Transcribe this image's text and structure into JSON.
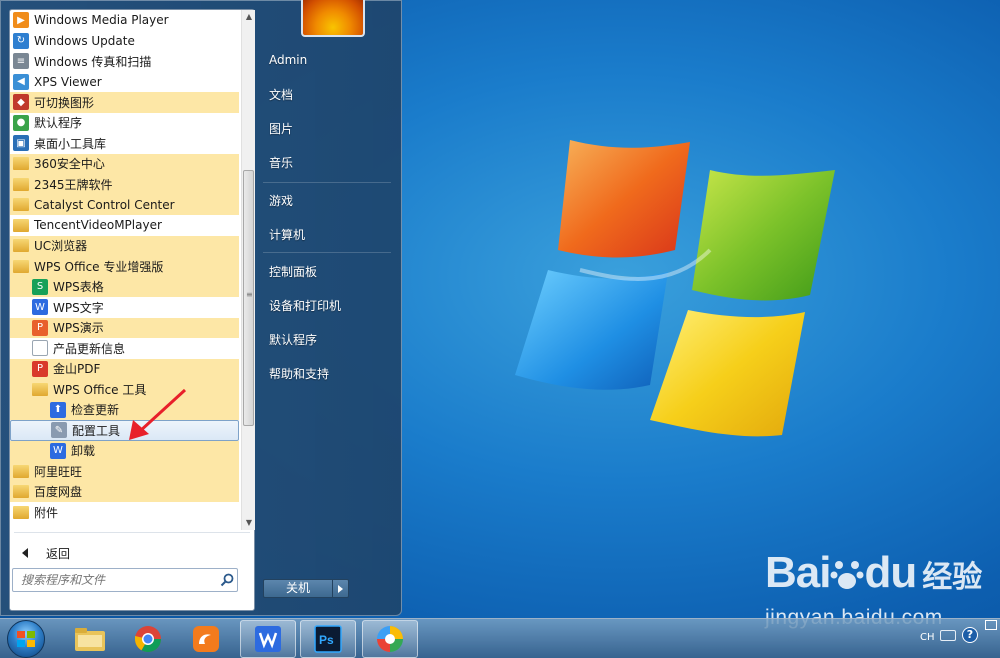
{
  "programs": [
    {
      "label": "Windows Media Player",
      "icon": "media-player-icon",
      "level": 0,
      "highlight": false
    },
    {
      "label": "Windows Update",
      "icon": "windows-update-icon",
      "level": 0,
      "highlight": false
    },
    {
      "label": "Windows 传真和扫描",
      "icon": "fax-scan-icon",
      "level": 0,
      "highlight": false
    },
    {
      "label": "XPS Viewer",
      "icon": "xps-viewer-icon",
      "level": 0,
      "highlight": false
    },
    {
      "label": "可切换图形",
      "icon": "switchable-graphics-icon",
      "level": 0,
      "highlight": true
    },
    {
      "label": "默认程序",
      "icon": "default-programs-icon",
      "level": 0,
      "highlight": false
    },
    {
      "label": "桌面小工具库",
      "icon": "gadgets-icon",
      "level": 0,
      "highlight": false
    },
    {
      "label": "360安全中心",
      "icon": "folder-icon",
      "level": 0,
      "highlight": true
    },
    {
      "label": "2345王牌软件",
      "icon": "folder-icon",
      "level": 0,
      "highlight": true
    },
    {
      "label": "Catalyst Control Center",
      "icon": "folder-icon",
      "level": 0,
      "highlight": true
    },
    {
      "label": "TencentVideoMPlayer",
      "icon": "folder-icon",
      "level": 0,
      "highlight": false
    },
    {
      "label": "UC浏览器",
      "icon": "folder-icon",
      "level": 0,
      "highlight": true
    },
    {
      "label": "WPS Office 专业增强版",
      "icon": "folder-icon",
      "level": 0,
      "highlight": true
    },
    {
      "label": "WPS表格",
      "icon": "wps-spreadsheet-icon",
      "level": 1,
      "highlight": true
    },
    {
      "label": "WPS文字",
      "icon": "wps-writer-icon",
      "level": 1,
      "highlight": false
    },
    {
      "label": "WPS演示",
      "icon": "wps-presentation-icon",
      "level": 1,
      "highlight": true
    },
    {
      "label": "产品更新信息",
      "icon": "document-icon",
      "level": 1,
      "highlight": false
    },
    {
      "label": "金山PDF",
      "icon": "kingsoft-pdf-icon",
      "level": 1,
      "highlight": true
    },
    {
      "label": "WPS Office 工具",
      "icon": "folder-icon",
      "level": 1,
      "highlight": true
    },
    {
      "label": "检查更新",
      "icon": "check-update-icon",
      "level": 2,
      "highlight": true
    },
    {
      "label": "配置工具",
      "icon": "config-tool-icon",
      "level": 2,
      "highlight": false,
      "selected": true
    },
    {
      "label": "卸载",
      "icon": "uninstall-icon",
      "level": 2,
      "highlight": true
    },
    {
      "label": "阿里旺旺",
      "icon": "folder-icon",
      "level": 0,
      "highlight": true
    },
    {
      "label": "百度网盘",
      "icon": "folder-icon",
      "level": 0,
      "highlight": true
    },
    {
      "label": "附件",
      "icon": "folder-icon",
      "level": 0,
      "highlight": false
    }
  ],
  "back_label": "返回",
  "search": {
    "placeholder": "搜索程序和文件"
  },
  "right_pane": {
    "items": [
      "Admin",
      "文档",
      "图片",
      "音乐",
      "游戏",
      "计算机",
      "控制面板",
      "设备和打印机",
      "默认程序",
      "帮助和支持"
    ]
  },
  "shutdown_label": "关机",
  "tray": {
    "lang": "CH",
    "help": "?"
  },
  "watermark": {
    "brand": "Bai",
    "brand2": "du",
    "cn": "经验",
    "url": "jingyan.baidu.com"
  },
  "colors": {
    "highlight": "#fde7a6",
    "accent": "#1a7ccb",
    "annotation": "#e8202a"
  }
}
